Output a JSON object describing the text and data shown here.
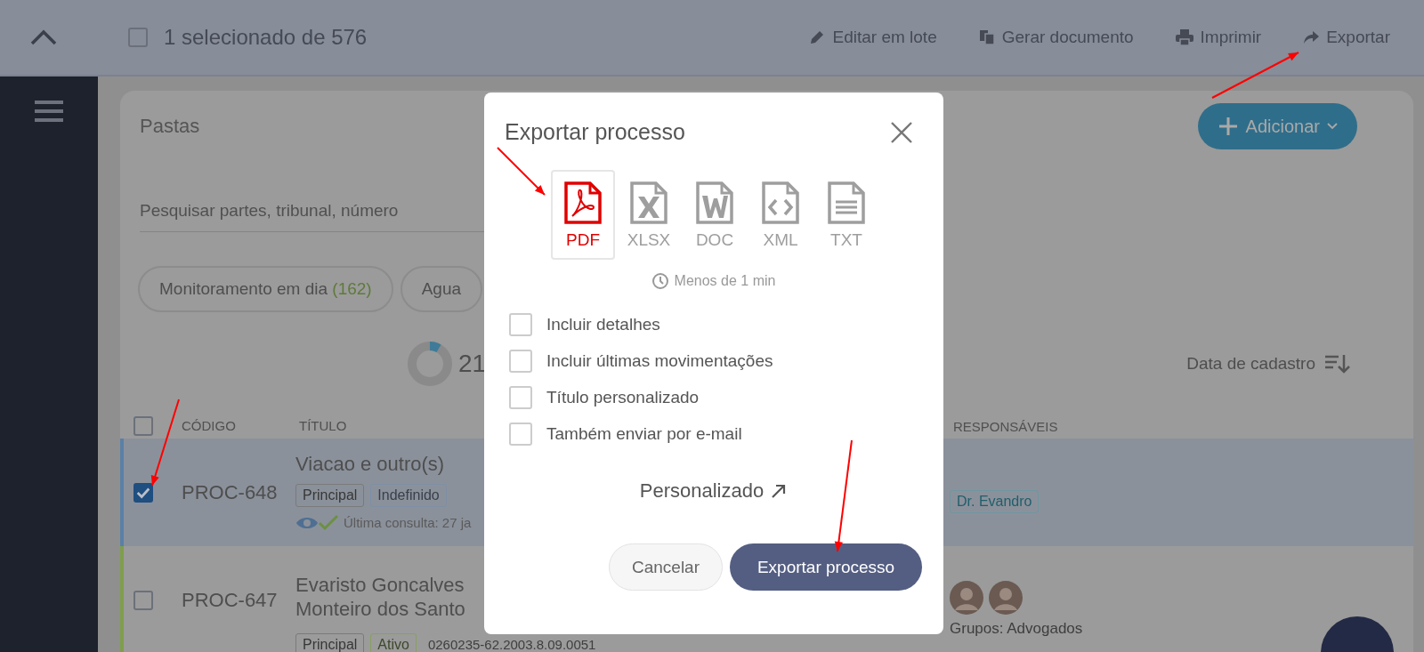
{
  "top_bar": {
    "select_all_checked": false,
    "selection_text": "1 selecionado de 576",
    "actions": [
      {
        "label": "Editar em lote"
      },
      {
        "label": "Gerar documento"
      },
      {
        "label": "Imprimir"
      },
      {
        "label": "Exportar"
      }
    ]
  },
  "card": {
    "title": "Pastas",
    "add_button": "Adicionar",
    "search": {
      "placeholder": "Pesquisar partes, tribunal, número"
    },
    "filters": [
      {
        "label": "Monitoramento em dia",
        "count": "(162)"
      },
      {
        "label": "Agua"
      }
    ],
    "summary_count": "21",
    "sort": "Data de cadastro",
    "table": {
      "header_checked": false,
      "columns": [
        "CÓDIGO",
        "TÍTULO",
        "RESPONSÁVEIS"
      ],
      "rows": [
        {
          "selected": true,
          "checked": true,
          "color": "#5a80a6",
          "code": "PROC-648",
          "title": [
            "Viacao e outro(s)"
          ],
          "tags": [
            {
              "label": "Principal",
              "color": "#7a7a7a"
            },
            {
              "label": "Indefinido",
              "color": "#7f8fa6"
            }
          ],
          "last_check": "Última consulta: 27 ja",
          "responsibles": [
            "Dr. Evandro"
          ]
        },
        {
          "selected": false,
          "checked": false,
          "color": "#7f9e4c",
          "code": "PROC-647",
          "title": [
            "Evaristo Goncalves",
            "Monteiro dos Santo"
          ],
          "tags": [
            {
              "label": "Principal",
              "color": "#7a7a7a"
            },
            {
              "label": "Ativo",
              "color": "#86a060"
            }
          ],
          "number": "0260235-62.2003.8.09.0051",
          "avatars": [
            {
              "kind": "picture"
            },
            {
              "kind": "picture"
            }
          ],
          "groups": "Grupos: Advogados"
        }
      ]
    }
  },
  "dialog": {
    "title": "Exportar processo",
    "formats": [
      {
        "kind": "pdf",
        "label": "PDF",
        "selected": true
      },
      {
        "kind": "xlsx",
        "label": "XLSX",
        "selected": false
      },
      {
        "kind": "doc",
        "label": "DOC",
        "selected": false
      },
      {
        "kind": "xml",
        "label": "XML",
        "selected": false
      },
      {
        "kind": "txt",
        "label": "TXT",
        "selected": false
      }
    ],
    "estimate": "Menos de 1 min",
    "options": [
      {
        "label": "Incluir detalhes",
        "checked": false
      },
      {
        "label": "Incluir últimas movimentações",
        "checked": false
      },
      {
        "label": "Título personalizado",
        "checked": false
      },
      {
        "label": "Também enviar por e-mail",
        "checked": false
      }
    ],
    "custom_link": "Personalizado",
    "cancel_button": "Cancelar",
    "confirm_button": "Exportar processo"
  }
}
